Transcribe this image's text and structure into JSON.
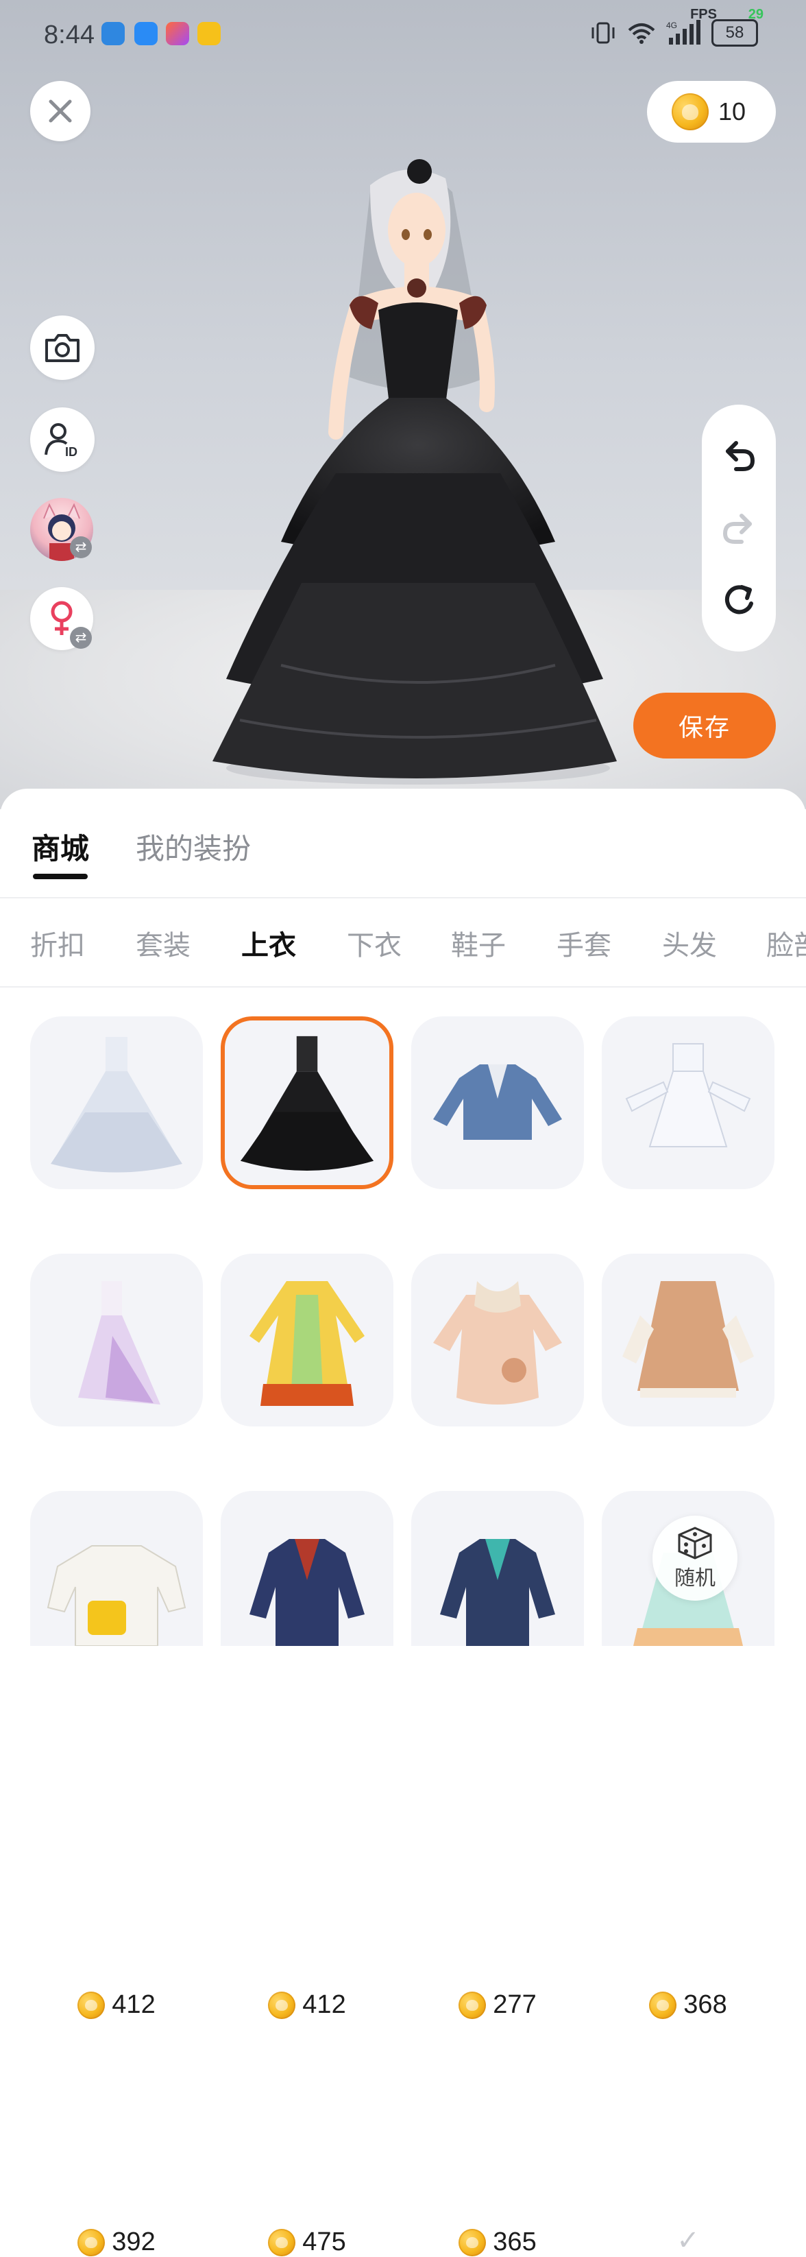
{
  "status": {
    "time": "8:44",
    "battery": "58",
    "fps_label": "FPS",
    "fps_value": "29",
    "network": "4G"
  },
  "header": {
    "coin_balance": "10"
  },
  "save_label": "保存",
  "tabs": {
    "main": [
      "商城",
      "我的装扮"
    ],
    "active_main": 0,
    "categories": [
      "折扣",
      "套装",
      "上衣",
      "下衣",
      "鞋子",
      "手套",
      "头发",
      "脸部"
    ],
    "active_category": 2
  },
  "items": [
    {
      "name": "white-layered-gown",
      "price": "412",
      "owned": false,
      "selected": false,
      "colors": [
        "#dfe4ef",
        "#bac3d6"
      ]
    },
    {
      "name": "black-layered-gown",
      "price": "412",
      "owned": false,
      "selected": true,
      "colors": [
        "#2a2a2c",
        "#141415"
      ]
    },
    {
      "name": "denim-jacket",
      "price": "277",
      "owned": false,
      "selected": false,
      "colors": [
        "#5d7fb0",
        "#3d5f92"
      ]
    },
    {
      "name": "white-lolita-dress",
      "price": "368",
      "owned": false,
      "selected": false,
      "colors": [
        "#f4f6fb",
        "#d6dbe6"
      ]
    },
    {
      "name": "lilac-gown",
      "price": "392",
      "owned": false,
      "selected": false,
      "colors": [
        "#f3eef7",
        "#c9a7e0"
      ]
    },
    {
      "name": "yellow-hanfu-robe",
      "price": "475",
      "owned": false,
      "selected": false,
      "colors": [
        "#f3cf4a",
        "#d9541f"
      ]
    },
    {
      "name": "peach-puffer-coat",
      "price": "365",
      "owned": false,
      "selected": false,
      "colors": [
        "#f2cdb6",
        "#d89b77"
      ]
    },
    {
      "name": "brown-cape-dress",
      "price": "",
      "owned": true,
      "selected": false,
      "colors": [
        "#d9a37c",
        "#b9774d"
      ]
    },
    {
      "name": "white-duck-sweater",
      "price": "",
      "owned": false,
      "selected": false,
      "colors": [
        "#f6f4ef",
        "#f4c51c"
      ]
    },
    {
      "name": "navy-red-coat",
      "price": "",
      "owned": false,
      "selected": false,
      "colors": [
        "#2d3a6a",
        "#b33a2b"
      ]
    },
    {
      "name": "teal-navy-coat",
      "price": "",
      "owned": false,
      "selected": false,
      "colors": [
        "#2e3e66",
        "#3fb6ad"
      ]
    },
    {
      "name": "mint-frill-dress",
      "price": "",
      "owned": false,
      "selected": false,
      "colors": [
        "#bfe8df",
        "#f2c08a"
      ]
    }
  ],
  "random_label": "随机",
  "colors": {
    "accent": "#f37321",
    "coin": "#f6b71e",
    "card_bg": "#f3f4f8"
  }
}
